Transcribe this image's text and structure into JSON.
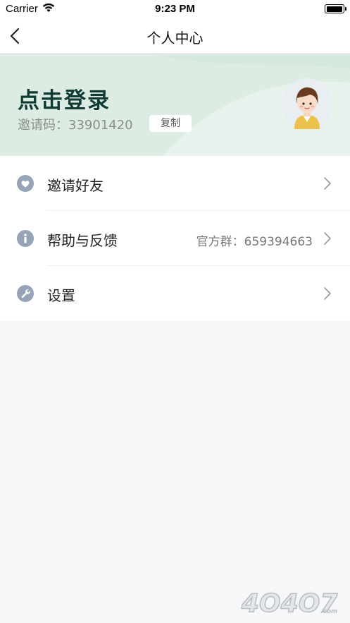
{
  "status_bar": {
    "carrier": "Carrier",
    "time": "9:23 PM"
  },
  "nav": {
    "title": "个人中心"
  },
  "profile": {
    "login_text": "点击登录",
    "invite_code_label": "邀请码：",
    "invite_code": "33901420",
    "copy_label": "复制"
  },
  "menu": {
    "items": [
      {
        "label": "邀请好友",
        "value": "",
        "icon": "heart-icon"
      },
      {
        "label": "帮助与反馈",
        "value": "官方群：659394663",
        "icon": "info-icon"
      },
      {
        "label": "设置",
        "value": "",
        "icon": "wrench-icon"
      }
    ]
  },
  "watermark": {
    "text": "4O4O7.com"
  },
  "colors": {
    "header_bg": "#dcece3",
    "login_text": "#0f3b34",
    "icon_gray": "#97a3b6",
    "page_bg": "#f6f7f9"
  }
}
